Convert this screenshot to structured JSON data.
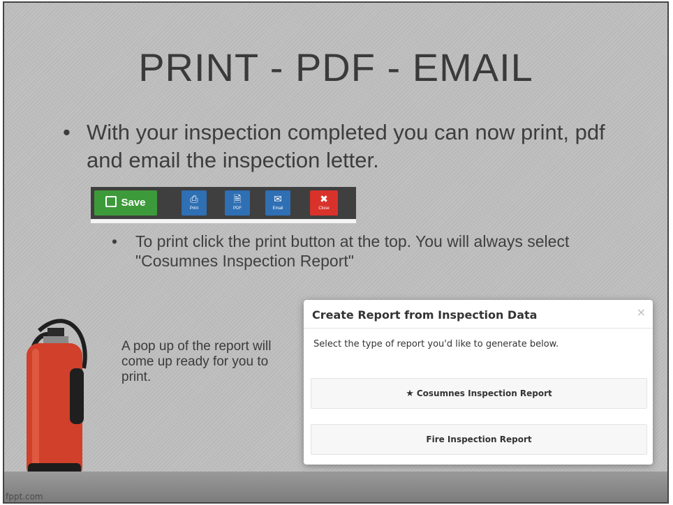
{
  "slide": {
    "title": "PRINT - PDF - EMAIL",
    "bullet_main": "With your inspection completed you can now print, pdf and email the inspection letter.",
    "bullet_sub": "To print click the print button at the top.  You will always select \"Cosumnes Inspection Report\"",
    "popup_note": "A pop up of the report will come up ready for you to print.",
    "footer_brand": "fppt.com",
    "bullet_glyph": "•"
  },
  "toolbar": {
    "save_label": "Save",
    "print_label": "Print",
    "pdf_label": "PDF",
    "email_label": "Email",
    "close_label": "Close",
    "colors": {
      "save": "#3d9a3a",
      "blue": "#2f6fb4",
      "close": "#d9322b",
      "bar": "#3f3f3f"
    }
  },
  "dialog": {
    "title": "Create Report from Inspection Data",
    "close_glyph": "×",
    "description": "Select the type of report you'd like to generate below.",
    "options": [
      {
        "label": "Cosumnes Inspection Report",
        "icon": "star-icon"
      },
      {
        "label": "Fire Inspection Report",
        "icon": ""
      }
    ]
  }
}
